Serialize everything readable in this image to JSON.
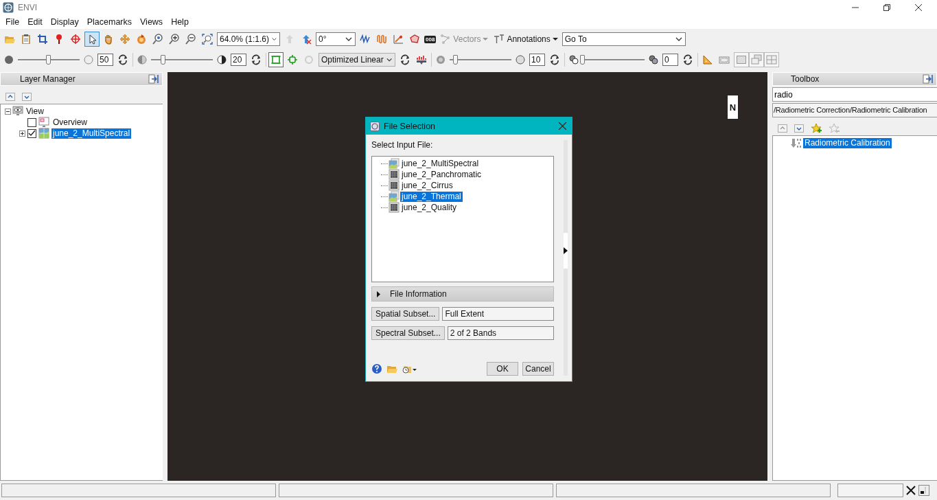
{
  "window": {
    "title": "ENVI"
  },
  "menu": [
    "File",
    "Edit",
    "Display",
    "Placemarks",
    "Views",
    "Help"
  ],
  "toolbar": {
    "tools": [
      {
        "selected": false
      },
      {
        "selected": false
      },
      {
        "selected": false
      },
      {
        "selected": false
      },
      {
        "selected": false
      },
      {
        "selected": true
      },
      {
        "selected": false
      },
      {
        "selected": false
      },
      {
        "selected": false
      },
      {
        "selected": false
      },
      {
        "selected": false
      },
      {
        "selected": false
      },
      {
        "selected": false
      }
    ],
    "zoom": "64.0% (1:1.6)",
    "rotation": "0°",
    "counter": "008",
    "vectors": {
      "label": "Vectors",
      "disabled": true
    },
    "annotations": {
      "label": "Annotations",
      "disabled": false
    },
    "goto": "Go To"
  },
  "display_bar": {
    "brightness": {
      "level": 0.5,
      "value": "50"
    },
    "contrast": {
      "level": 0.2,
      "value": "20"
    },
    "stretch": "Optimized Linear",
    "sharpen": {
      "level": 0.1,
      "value": "10"
    },
    "transparency": {
      "level": 0,
      "value": "0"
    }
  },
  "layer_manager": {
    "title": "Layer Manager",
    "tree": [
      {
        "label": "View",
        "expanded": true,
        "children": [
          {
            "label": "Overview",
            "checked": false,
            "selected": false
          },
          {
            "label": "june_2_MultiSpectral",
            "checked": true,
            "selected": true,
            "expanded": false
          }
        ]
      }
    ]
  },
  "view": {
    "north_label": "N"
  },
  "file_selection": {
    "title": "File Selection",
    "prompt": "Select Input File:",
    "files": [
      {
        "name": "june_2_MultiSpectral",
        "kind": "multi",
        "selected": false
      },
      {
        "name": "june_2_Panchromatic",
        "kind": "single",
        "selected": false
      },
      {
        "name": "june_2_Cirrus",
        "kind": "single",
        "selected": false
      },
      {
        "name": "june_2_Thermal",
        "kind": "multi",
        "selected": true
      },
      {
        "name": "june_2_Quality",
        "kind": "single",
        "selected": false
      }
    ],
    "file_information": {
      "label": "File Information",
      "expanded": false
    },
    "spatial_subset": {
      "button": "Spatial Subset...",
      "value": "Full Extent"
    },
    "spectral_subset": {
      "button": "Spectral Subset...",
      "value": "2 of 2 Bands"
    },
    "buttons": [
      "OK",
      "Cancel"
    ]
  },
  "toolbox": {
    "title": "Toolbox",
    "search": "radio",
    "path": "/Radiometric Correction/Radiometric Calibration",
    "items": [
      {
        "label": "Radiometric Calibration",
        "selected": true
      }
    ]
  }
}
